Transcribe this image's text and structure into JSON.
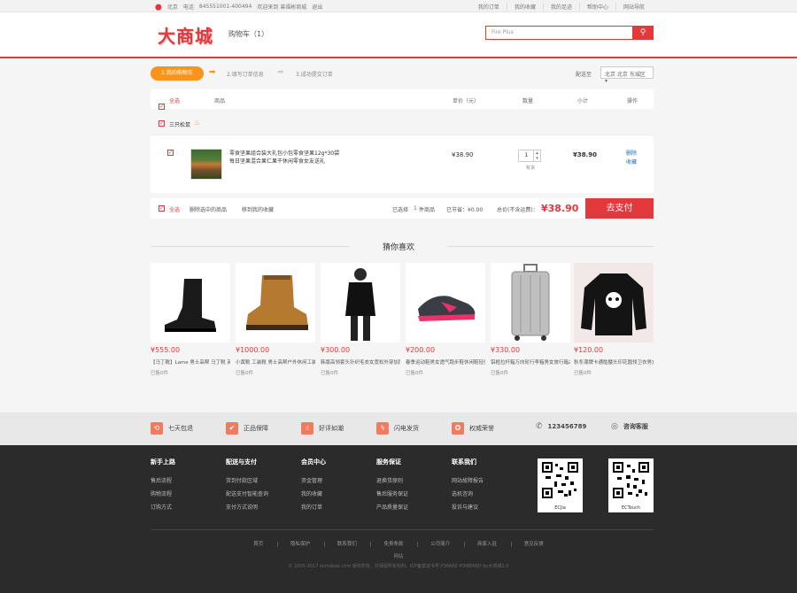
{
  "topbar": {
    "location": "北京",
    "phone_label": "电话",
    "phone": "845551001-400494",
    "welcome": "欢迎来到 曾福彬商城",
    "logout": "退出",
    "links": [
      "我的订单",
      "我的收藏",
      "我的足迹",
      "帮助中心",
      "网站导航"
    ]
  },
  "header": {
    "logo": "大商城",
    "cart_label": "购物车（1）",
    "search_placeholder": "Fire Plus"
  },
  "steps": {
    "step1": "1.我的购物车",
    "step2": "2.填写订单信息",
    "step3": "3.成功提交订单",
    "ship_label": "配送至",
    "ship_value": "北京 北京 东城区"
  },
  "cart": {
    "headers": {
      "select_all": "全选",
      "product": "商品",
      "price": "单价（元）",
      "qty": "数量",
      "subtotal": "小计",
      "ops": "操作"
    },
    "shop_name": "三只松鼠",
    "item": {
      "title": "零食坚果组合装大礼包小包零食坚果12g*30袋每日坚果混合果仁果干休闲零食女友送礼",
      "price": "¥38.90",
      "qty": "1",
      "stock": "有货",
      "subtotal": "¥38.90",
      "op_delete": "删除",
      "op_collect": "收藏"
    },
    "footer": {
      "select_all": "全选",
      "delete_selected": "删除选中的商品",
      "move_collect": "移到我的收藏",
      "selected_label": "已选择",
      "selected_count": "1",
      "selected_unit": "件商品",
      "discount": "已节省：¥0.00",
      "total_label": "总价(不含运费)：",
      "total": "¥38.90",
      "pay_button": "去支付"
    }
  },
  "guess": {
    "title": "猜你喜欢",
    "products": [
      {
        "price": "¥555.00",
        "name": "【马丁靴】Lame 男士高帮 马丁靴 英伦风",
        "sold": "已售0件"
      },
      {
        "price": "¥1000.00",
        "name": "小黄靴 工装靴 男士高帮户外休闲工装鞋",
        "sold": "已售0件"
      },
      {
        "price": "¥300.00",
        "name": "韩版高领套头针织毛衣女宽松外穿加厚",
        "sold": "已售0件"
      },
      {
        "price": "¥200.00",
        "name": "春季运动鞋男女透气跑步鞋休闲鞋轻便",
        "sold": "已售0件"
      },
      {
        "price": "¥330.00",
        "name": "铝框拉杆箱万向轮行李箱男女旅行箱24寸",
        "sold": "已售0件"
      },
      {
        "price": "¥120.00",
        "name": "秋冬潮牌卡通骷髅头印花圆领卫衣男女",
        "sold": "已售0件"
      }
    ]
  },
  "service": {
    "items": [
      "七天包退",
      "正品保障",
      "好评如潮",
      "闪电发货",
      "权威荣誉"
    ],
    "phone": "123456789",
    "consult": "咨询客服"
  },
  "footer": {
    "columns": [
      {
        "title": "新手上路",
        "links": [
          "售后流程",
          "购物流程",
          "订购方式"
        ]
      },
      {
        "title": "配送与支付",
        "links": [
          "货到付款区域",
          "配送支付智能查询",
          "支付方式说明"
        ]
      },
      {
        "title": "会员中心",
        "links": [
          "资金管理",
          "我的收藏",
          "我的订单"
        ]
      },
      {
        "title": "服务保证",
        "links": [
          "退换货原则",
          "售后服务保证",
          "产品质量保证"
        ]
      },
      {
        "title": "联系我们",
        "links": [
          "网站故障报告",
          "选机咨询",
          "投诉与建议"
        ]
      }
    ],
    "qr1_caption": "ECJia",
    "qr2_caption": "ECTouch",
    "links": [
      "首页",
      "隐私保护",
      "联系我们",
      "免责条款",
      "公司简介",
      "商家入驻",
      "意见反馈"
    ],
    "site_map": "网站",
    "copyright": "© 2005-2017 ecmoban.com 版权所有，并保留所有权利。ICP备案证书号:P36666 POWERED by大商城2.0"
  },
  "colors": {
    "accent": "#e4393c",
    "step": "#f7941d",
    "service_icon": "#f07c60"
  }
}
